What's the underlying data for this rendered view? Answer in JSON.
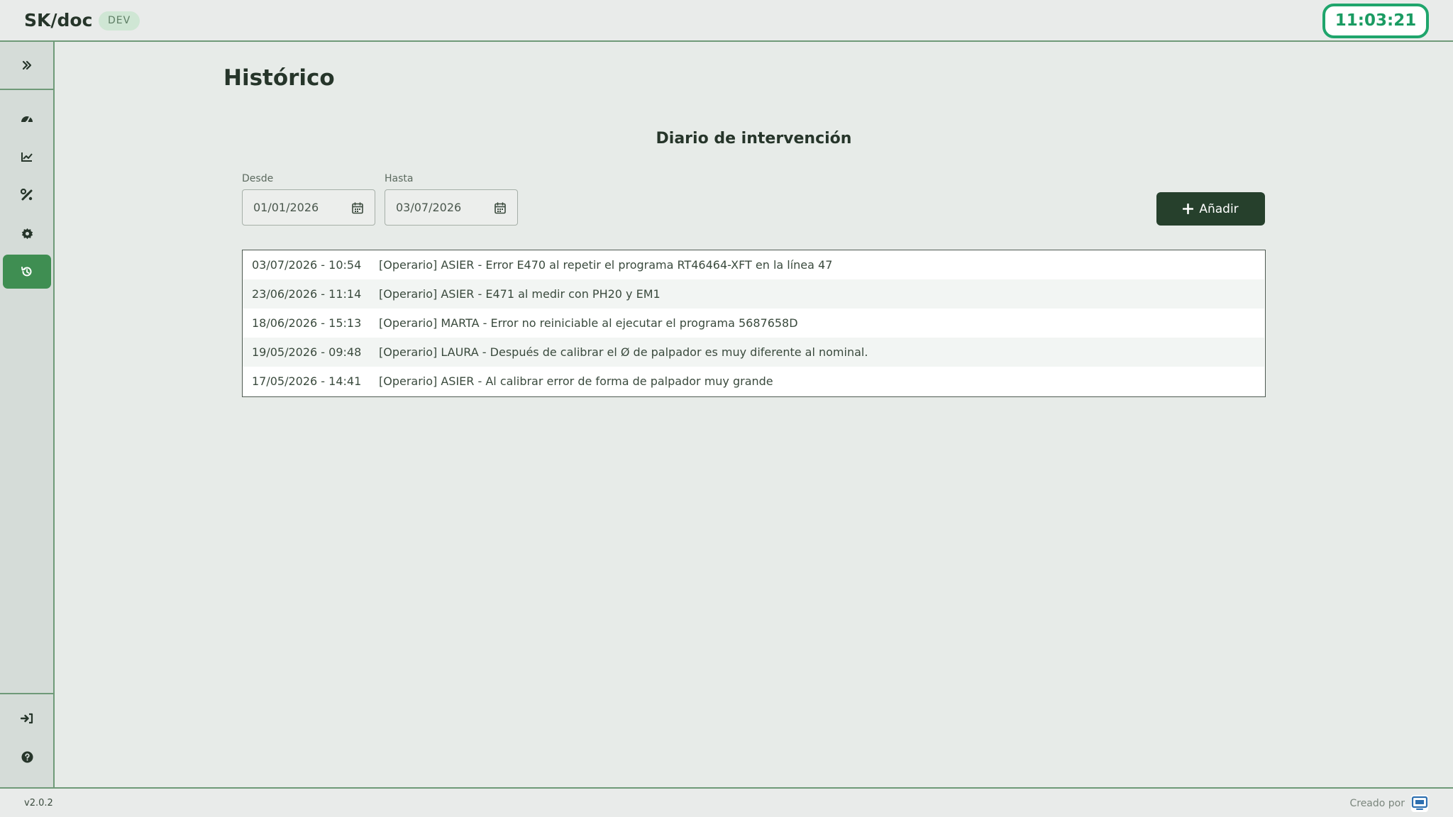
{
  "header": {
    "brand": "SK/doc",
    "env_badge": "DEV",
    "clock": "11:03:21"
  },
  "sidebar": {
    "toggle_icon": "double-chevron-right-icon",
    "items": [
      {
        "icon": "dashboard-gauge-icon",
        "active": false
      },
      {
        "icon": "line-chart-icon",
        "active": false
      },
      {
        "icon": "tools-icon",
        "active": false
      },
      {
        "icon": "gear-icon",
        "active": false
      },
      {
        "icon": "history-icon",
        "active": true
      }
    ],
    "bottom_items": [
      {
        "icon": "login-icon"
      },
      {
        "icon": "help-icon"
      }
    ]
  },
  "main": {
    "page_title": "Histórico",
    "section_title": "Diario de intervención",
    "filters": {
      "from_label": "Desde",
      "from_value": "01/01/2026",
      "to_label": "Hasta",
      "to_value": "03/07/2026"
    },
    "add_button_label": "Añadir",
    "log_entries": [
      {
        "date": "03/07/2026 - 10:54",
        "text": "[Operario] ASIER - Error E470 al repetir el programa RT46464-XFT en la línea 47"
      },
      {
        "date": "23/06/2026 - 11:14",
        "text": "[Operario] ASIER - E471 al medir con PH20 y EM1"
      },
      {
        "date": "18/06/2026 - 15:13",
        "text": "[Operario] MARTA - Error no reiniciable al ejecutar el programa 5687658D"
      },
      {
        "date": "19/05/2026 - 09:48",
        "text": "[Operario] LAURA - Después de calibrar el Ø de palpador es muy diferente al nominal."
      },
      {
        "date": "17/05/2026 - 14:41",
        "text": "[Operario] ASIER - Al calibrar error de forma de palpador muy grande"
      }
    ]
  },
  "footer": {
    "version": "v2.0.2",
    "credit": "Creado por"
  },
  "colors": {
    "accent_green": "#1fa56c",
    "active_nav": "#3f8e52",
    "primary_button": "#26402c",
    "border_green": "#6f9a78"
  }
}
